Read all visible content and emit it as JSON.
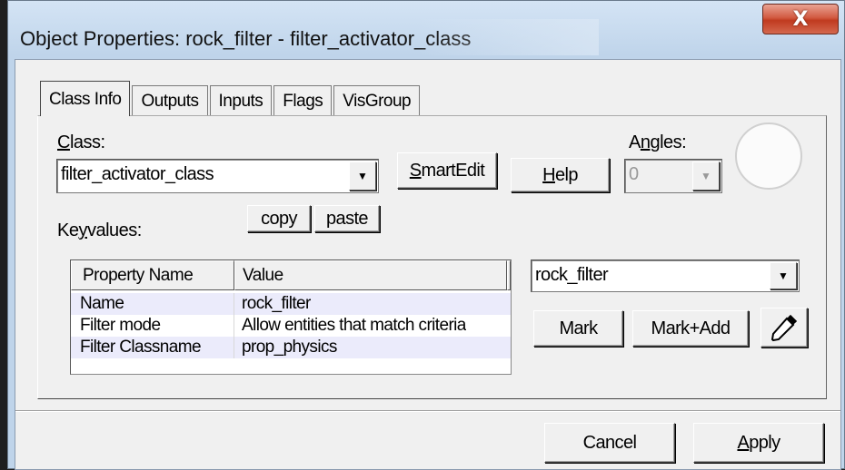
{
  "window": {
    "title": "Object Properties: rock_filter - filter_activator_class",
    "close_glyph": "X"
  },
  "tabs": [
    {
      "label": "Class Info"
    },
    {
      "label": "Outputs"
    },
    {
      "label": "Inputs"
    },
    {
      "label": "Flags"
    },
    {
      "label": "VisGroup"
    }
  ],
  "class_info": {
    "class_label_first": "C",
    "class_label_rest": "lass:",
    "class_value": "filter_activator_class",
    "smartedit_first": "S",
    "smartedit_rest": "martEdit",
    "help_first": "H",
    "help_rest": "elp",
    "angles_pre": "A",
    "angles_u": "n",
    "angles_rest": "gles:",
    "angles_value": "0",
    "keyvalues_pre": "Ke",
    "keyvalues_u": "y",
    "keyvalues_rest": "values:",
    "copy_label": "copy",
    "paste_label": "paste"
  },
  "grid": {
    "headers": [
      "Property Name",
      "Value"
    ],
    "rows": [
      {
        "name": "Name",
        "value": "rock_filter"
      },
      {
        "name": "Filter mode",
        "value": "Allow entities that match criteria"
      },
      {
        "name": "Filter Classname",
        "value": "prop_physics"
      }
    ]
  },
  "target": {
    "value": "rock_filter",
    "mark_label": "Mark",
    "mark_add_label": "Mark+Add",
    "picker_icon": "eyedropper-icon"
  },
  "footer": {
    "cancel_label": "Cancel",
    "apply_first": "A",
    "apply_rest": "pply"
  },
  "colors": {
    "close_button": "#c9452a",
    "selected_row": "#ebebfb"
  }
}
